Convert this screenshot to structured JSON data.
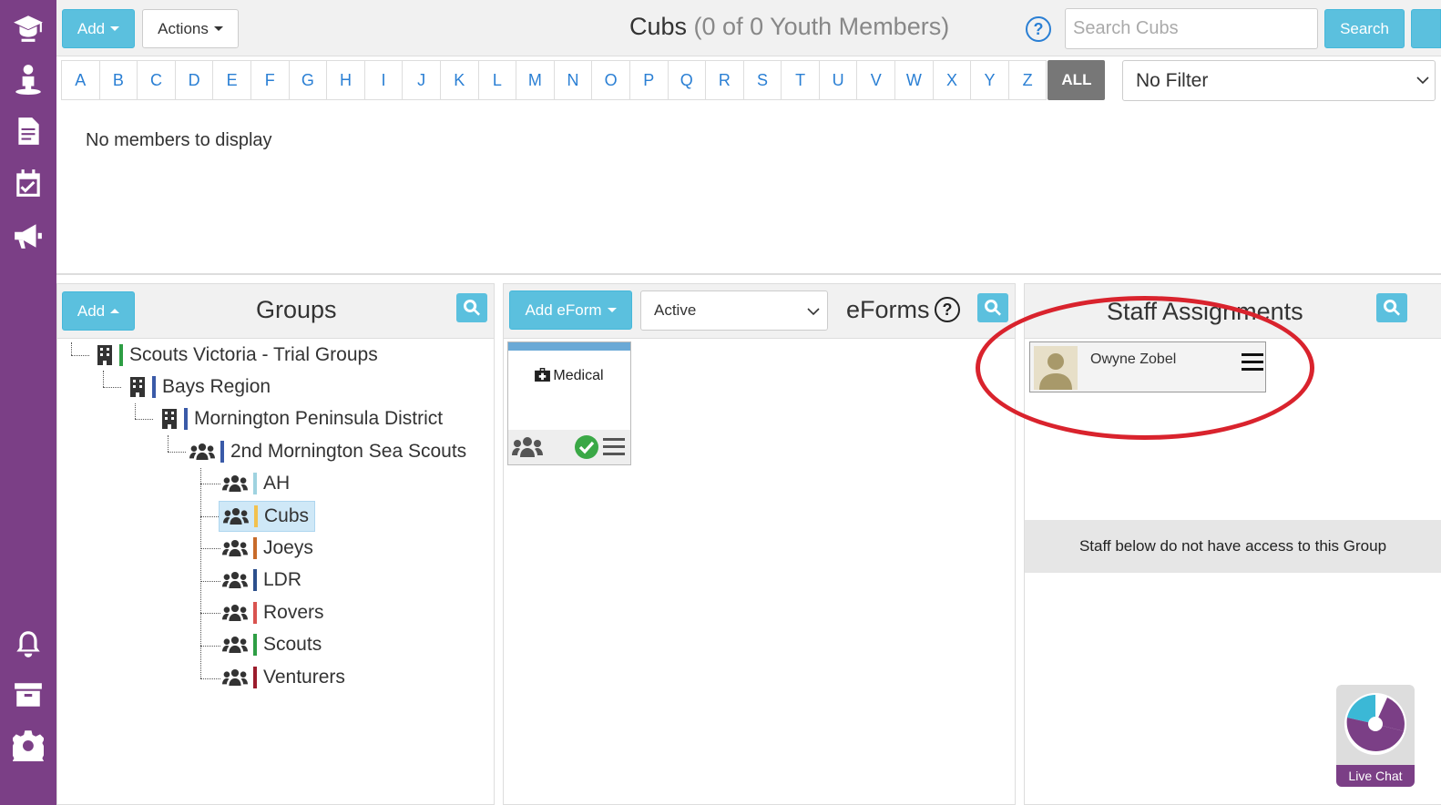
{
  "colors": {
    "rail": "#7b3f86",
    "accent": "#5bc0de",
    "link": "#2a7fd4",
    "highlight": "#d9232d"
  },
  "rail": {
    "icons": [
      "graduation-cap-icon",
      "person-icon",
      "document-icon",
      "calendar-check-icon",
      "megaphone-icon",
      "bell-icon",
      "archive-icon",
      "gear-icon"
    ]
  },
  "toolbar": {
    "add_label": "Add",
    "actions_label": "Actions",
    "title": "Cubs",
    "subtitle": "(0 of 0 Youth Members)",
    "search_placeholder": "Search Cubs",
    "search_label": "Search"
  },
  "alphabet": [
    "A",
    "B",
    "C",
    "D",
    "E",
    "F",
    "G",
    "H",
    "I",
    "J",
    "K",
    "L",
    "M",
    "N",
    "O",
    "P",
    "Q",
    "R",
    "S",
    "T",
    "U",
    "V",
    "W",
    "X",
    "Y",
    "Z"
  ],
  "alphabet_all": "ALL",
  "filter": {
    "selected": "No Filter"
  },
  "members": {
    "empty_text": "No members to display"
  },
  "groups": {
    "add_label": "Add",
    "title": "Groups",
    "tree": [
      {
        "label": "Scouts Victoria - Trial Groups",
        "color": "#2e9e44"
      },
      {
        "label": "Bays Region",
        "color": "#3a5aa8"
      },
      {
        "label": "Mornington Peninsula District",
        "color": "#3a5aa8"
      },
      {
        "label": "2nd Mornington Sea Scouts",
        "color": "#3a5aa8"
      },
      {
        "label": "AH",
        "color": "#9fd3e0"
      },
      {
        "label": "Cubs",
        "color": "#f2c14e"
      },
      {
        "label": "Joeys",
        "color": "#c86b2a"
      },
      {
        "label": "LDR",
        "color": "#2c4f8c"
      },
      {
        "label": "Rovers",
        "color": "#d9534f"
      },
      {
        "label": "Scouts",
        "color": "#2e9e44"
      },
      {
        "label": "Venturers",
        "color": "#9b1c2c"
      }
    ]
  },
  "eforms": {
    "add_label": "Add eForm",
    "status_selected": "Active",
    "title": "eForms",
    "cards": [
      {
        "label": "Medical"
      }
    ]
  },
  "staff": {
    "title": "Staff Assignments",
    "members": [
      {
        "name": "Owyne Zobel"
      }
    ],
    "no_access_text": "Staff below do not have access to this Group"
  },
  "livechat": {
    "label": "Live Chat"
  }
}
